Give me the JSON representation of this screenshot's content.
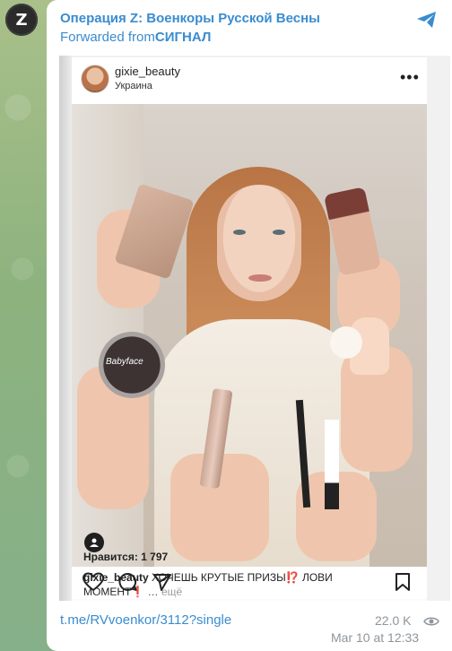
{
  "channel": {
    "avatar_letter": "Z",
    "title": "Операция Z: Военкоры Русской Весны",
    "forwarded_prefix": "Forwarded from",
    "forwarded_source": "СИГНАЛ"
  },
  "post": {
    "username": "gixie_beauty",
    "location": "Украина",
    "menu_icon": "more-dots-icon",
    "likes_text": "Нравится: 1 797",
    "caption_user": "gixie_beauty",
    "caption_text": " ХОЧЕШЬ КРУТЫЕ ПРИЗЫ⁉️ ЛОВИ МОМЕНТ❗ … ",
    "caption_more": "ещё",
    "product_labels": [
      "Babyface"
    ]
  },
  "footer": {
    "link": "t.me/RVvoenkor/3112?single",
    "views": "22.0 K",
    "date": "Mar 10 at 12:33"
  },
  "colors": {
    "link_blue": "#3a8ccf",
    "meta_gray": "#8e959b"
  }
}
